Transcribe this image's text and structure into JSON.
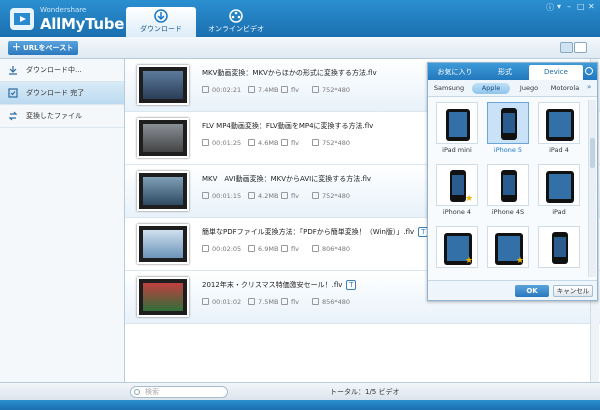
{
  "app": {
    "brand_top": "Wondershare",
    "brand": "AllMyTube"
  },
  "tabs": [
    {
      "label": "ダウンロード"
    },
    {
      "label": "オンラインビデオ"
    }
  ],
  "window_controls": [
    "ⓘ",
    "▾",
    "–",
    "□",
    "✕"
  ],
  "toolbar": {
    "add_url": "URLをペースト"
  },
  "sidebar": {
    "items": [
      {
        "label": "ダウンロード中..."
      },
      {
        "label": "ダウンロード 完了"
      },
      {
        "label": "変換したファイル"
      }
    ]
  },
  "videos": [
    {
      "title": "MKV動画変換：MKVからほかの形式に変換する方法.flv",
      "duration": "00:02:21",
      "size": "7.4MB",
      "format": "flv",
      "resolution": "752*480",
      "badge": ""
    },
    {
      "title": "FLV MP4動画変換：FLV動画をMP4に変換する方法.flv",
      "duration": "00:01:25",
      "size": "4.6MB",
      "format": "flv",
      "resolution": "752*480",
      "badge": ""
    },
    {
      "title": "MKV　AVI動画変換：MKVからAVIに変換する方法.flv",
      "duration": "00:01:15",
      "size": "4.2MB",
      "format": "flv",
      "resolution": "752*480",
      "badge": ""
    },
    {
      "title": "簡単なPDFファイル変換方法：「PDFから簡単変換！（Win版）」.flv",
      "duration": "00:02:05",
      "size": "6.9MB",
      "format": "flv",
      "resolution": "806*480",
      "badge": "T"
    },
    {
      "title": "2012年末・クリスマス特価激安セール！.flv",
      "duration": "00:01:02",
      "size": "7.5MB",
      "format": "flv",
      "resolution": "856*480",
      "badge": "T"
    }
  ],
  "statusbar": {
    "search_placeholder": "検索",
    "total": "トータル：1/5 ビデオ"
  },
  "popup": {
    "tabs": [
      {
        "label": "お気に入り"
      },
      {
        "label": "形式"
      },
      {
        "label": "Device"
      }
    ],
    "brands": [
      "Samsung",
      "Apple",
      "Juego",
      "Motorola"
    ],
    "devices": [
      {
        "label": "iPad mini",
        "kind": "pad",
        "star": false
      },
      {
        "label": "iPhone 5",
        "kind": "phone",
        "star": false
      },
      {
        "label": "iPad 4",
        "kind": "pad",
        "star": false
      },
      {
        "label": "iPhone 4",
        "kind": "phone",
        "star": true
      },
      {
        "label": "iPhone 4S",
        "kind": "phone",
        "star": false
      },
      {
        "label": "iPad",
        "kind": "pad",
        "star": false
      },
      {
        "label": "",
        "kind": "pad",
        "star": true
      },
      {
        "label": "",
        "kind": "pad",
        "star": true
      },
      {
        "label": "",
        "kind": "phone",
        "star": false
      }
    ],
    "ok": "OK",
    "cancel": "キャンセル"
  },
  "colors": {
    "accent": "#2278bd",
    "selected_text": "#1a78c8",
    "star": "#f0b400"
  }
}
